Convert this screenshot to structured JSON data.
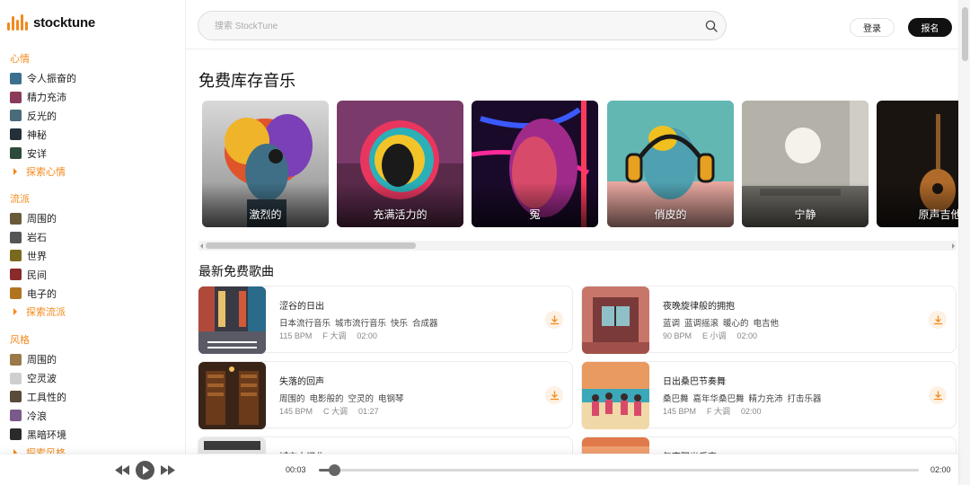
{
  "brand": {
    "name": "stocktune",
    "accent": "#f28a1c"
  },
  "search": {
    "placeholder": "搜索 StockTune",
    "icon": "search-icon"
  },
  "header": {
    "login_label": "登录",
    "signup_label": "报名"
  },
  "sidebar": {
    "mood": {
      "heading": "心情",
      "items": [
        {
          "label": "令人振奋的",
          "color": "#3b6f8f"
        },
        {
          "label": "精力充沛",
          "color": "#8a3b5a"
        },
        {
          "label": "反光的",
          "color": "#4a6b7a"
        },
        {
          "label": "神秘",
          "color": "#23303a"
        },
        {
          "label": "安详",
          "color": "#2e4a3a"
        }
      ],
      "explore": "探索心情"
    },
    "genre": {
      "heading": "流派",
      "items": [
        {
          "label": "周围的",
          "color": "#6b5a3a"
        },
        {
          "label": "岩石",
          "color": "#555555"
        },
        {
          "label": "世界",
          "color": "#7a6a1f"
        },
        {
          "label": "民间",
          "color": "#8a2a2a"
        },
        {
          "label": "电子的",
          "color": "#b07420"
        }
      ],
      "explore": "探索流派"
    },
    "style": {
      "heading": "风格",
      "items": [
        {
          "label": "周围的",
          "color": "#9a7a4a"
        },
        {
          "label": "空灵波",
          "color": "#cfcfcf"
        },
        {
          "label": "工具性的",
          "color": "#5a4a3a"
        },
        {
          "label": "冷浪",
          "color": "#7a5a8a"
        },
        {
          "label": "黑暗环境",
          "color": "#2a2a2a"
        }
      ],
      "explore": "探索风格"
    }
  },
  "main": {
    "library_title": "免费库存音乐",
    "cards": [
      {
        "label": "激烈的"
      },
      {
        "label": "充满活力的"
      },
      {
        "label": "冤"
      },
      {
        "label": "俏皮的"
      },
      {
        "label": "宁静"
      },
      {
        "label": "原声吉他"
      }
    ],
    "latest_title": "最新免费歌曲",
    "songs": [
      {
        "title": "涩谷的日出",
        "tags": [
          "日本流行音乐",
          "城市流行音乐",
          "快乐",
          "合成器"
        ],
        "bpm": "115 BPM",
        "key": "F 大调",
        "duration": "02:00"
      },
      {
        "title": "夜晚旋律般的拥抱",
        "tags": [
          "蓝调",
          "蓝调摇滚",
          "暖心的",
          "电吉他"
        ],
        "bpm": "90 BPM",
        "key": "E 小调",
        "duration": "02:00"
      },
      {
        "title": "失落的回声",
        "tags": [
          "周围的",
          "电影般的",
          "空灵的",
          "电钢琴"
        ],
        "bpm": "145 BPM",
        "key": "C 大调",
        "duration": "01:27"
      },
      {
        "title": "日出桑巴节奏舞",
        "tags": [
          "桑巴舞",
          "嘉年华桑巴舞",
          "精力充沛",
          "打击乐器"
        ],
        "bpm": "145 BPM",
        "key": "F 大调",
        "duration": "02:00"
      },
      {
        "title": "城市中间曲",
        "tags": [],
        "bpm": "",
        "key": "",
        "duration": ""
      },
      {
        "title": "午夜阳光乐声",
        "tags": [],
        "bpm": "",
        "key": "",
        "duration": ""
      }
    ]
  },
  "player": {
    "current_time": "00:03",
    "total_time": "02:00",
    "progress": 0.025
  }
}
